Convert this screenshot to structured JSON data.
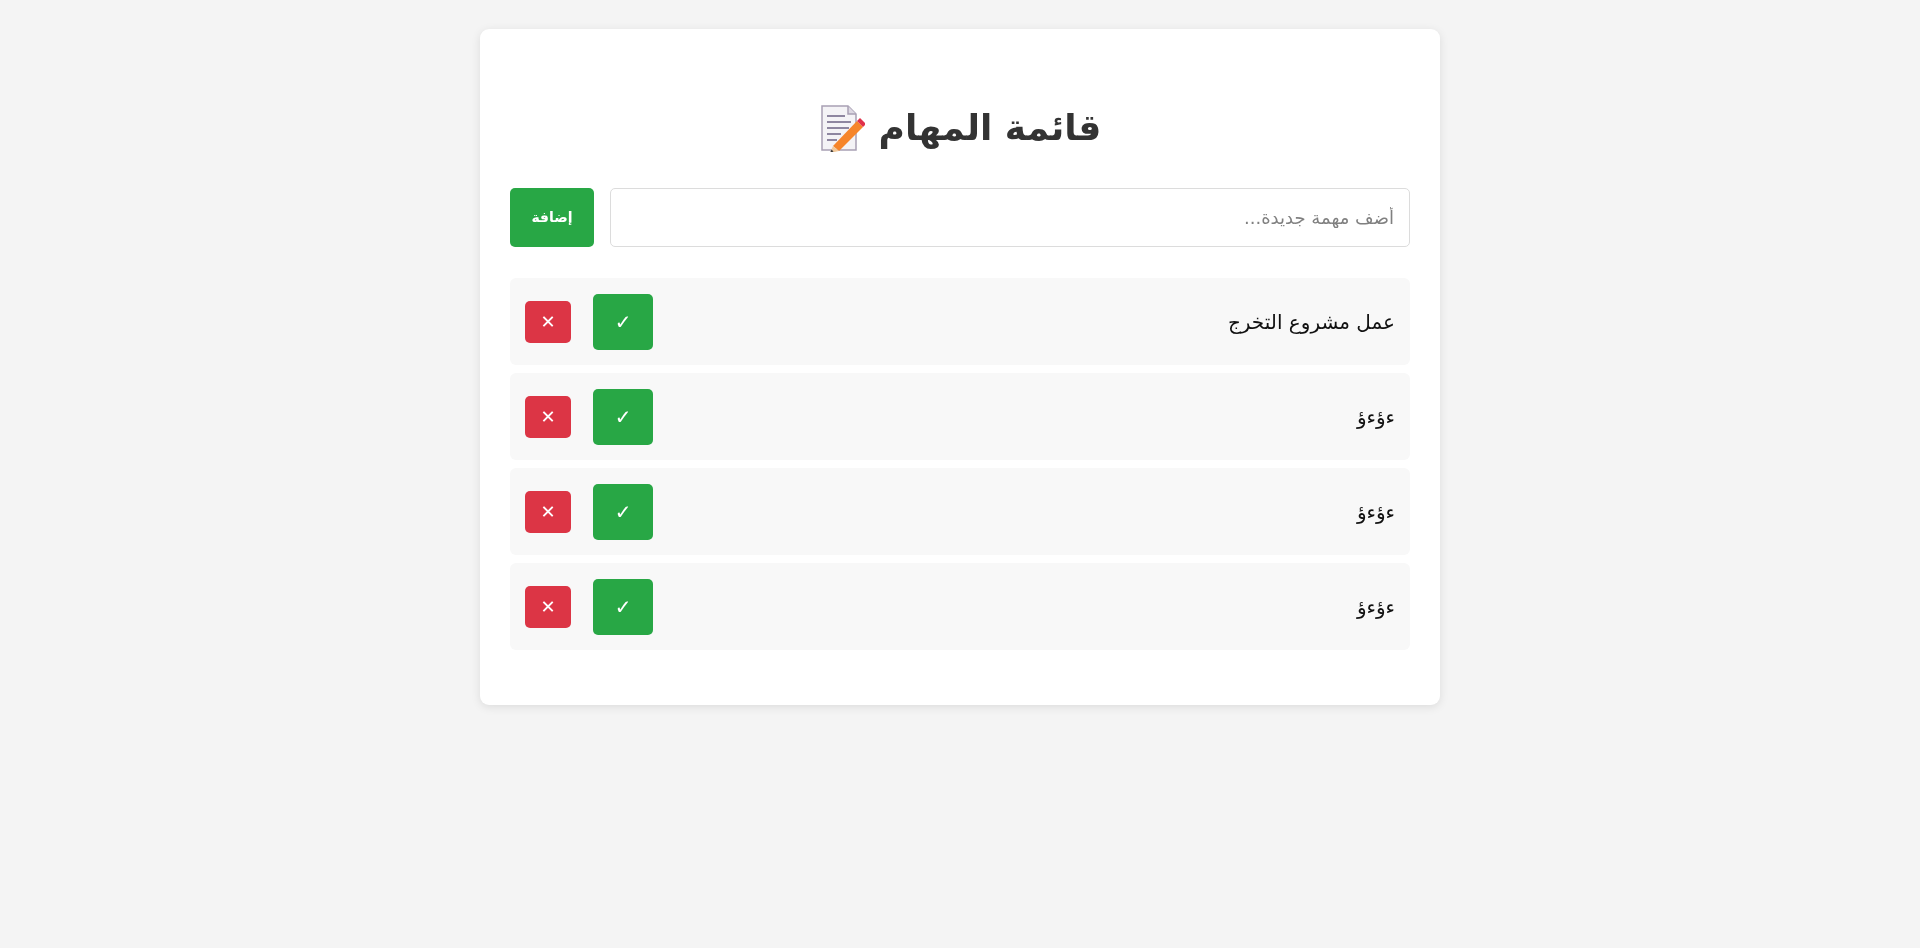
{
  "title": "قائمة المهام",
  "new_task": {
    "placeholder": "أضف مهمة جديدة...",
    "add_button": "إضافة"
  },
  "tasks": [
    {
      "text": "عمل مشروع التخرج",
      "complete_button": "✓",
      "delete_button": "✕"
    },
    {
      "text": "ءؤءؤ",
      "complete_button": "✓",
      "delete_button": "✕"
    },
    {
      "text": "ءؤءؤ",
      "complete_button": "✓",
      "delete_button": "✕"
    },
    {
      "text": "ءؤءؤ",
      "complete_button": "✓",
      "delete_button": "✕"
    }
  ]
}
